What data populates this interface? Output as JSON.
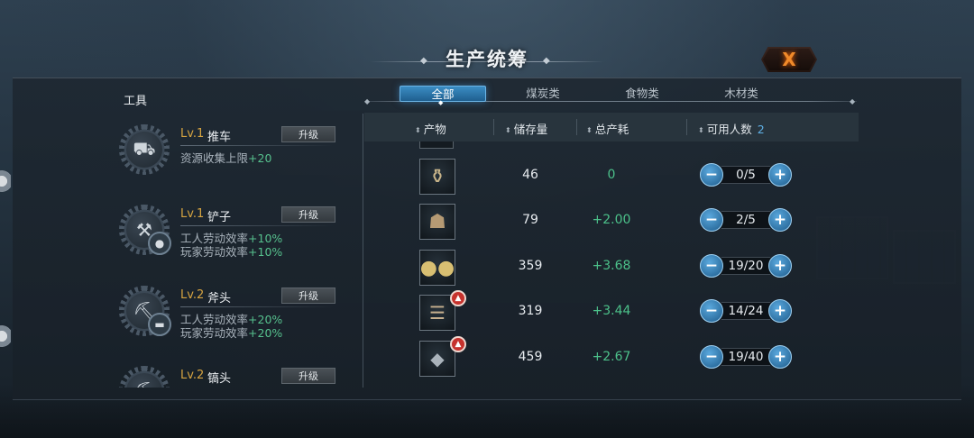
{
  "window": {
    "title": "生产统筹",
    "close_label": "X"
  },
  "tools": {
    "title": "工具",
    "upgrade_label": "升级",
    "items": [
      {
        "level": "Lv.1",
        "name": "推车",
        "effects": [
          {
            "label": "资源收集上限",
            "value": "+20"
          }
        ]
      },
      {
        "level": "Lv.1",
        "name": "铲子",
        "effects": [
          {
            "label": "工人劳动效率",
            "value": "+10%"
          },
          {
            "label": "玩家劳动效率",
            "value": "+10%"
          }
        ]
      },
      {
        "level": "Lv.2",
        "name": "斧头",
        "effects": [
          {
            "label": "工人劳动效率",
            "value": "+20%"
          },
          {
            "label": "玩家劳动效率",
            "value": "+20%"
          }
        ]
      },
      {
        "level": "Lv.2",
        "name": "镐头",
        "effects": []
      }
    ]
  },
  "tabs": [
    {
      "label": "全部",
      "active": true
    },
    {
      "label": "煤炭类",
      "active": false
    },
    {
      "label": "食物类",
      "active": false
    },
    {
      "label": "木材类",
      "active": false
    }
  ],
  "table": {
    "columns": {
      "product": "产物",
      "stock": "储存量",
      "production": "总产耗",
      "workers": "可用人数"
    },
    "available_workers": "2",
    "rows": [
      {
        "icon": "jar-icon",
        "stock": "46",
        "production": "0",
        "workers": "0/5",
        "boost": false
      },
      {
        "icon": "sack-icon",
        "stock": "79",
        "production": "+2.00",
        "workers": "2/5",
        "boost": false
      },
      {
        "icon": "potato-icon",
        "stock": "359",
        "production": "+3.68",
        "workers": "19/20",
        "boost": false
      },
      {
        "icon": "wood-log-icon",
        "stock": "319",
        "production": "+3.44",
        "workers": "14/24",
        "boost": true
      },
      {
        "icon": "coal-icon",
        "stock": "459",
        "production": "+2.67",
        "workers": "19/40",
        "boost": true
      }
    ]
  },
  "colors": {
    "accent_blue": "#3b8dc4",
    "positive_green": "#4cc18a",
    "level_gold": "#d6a441",
    "close_orange": "#f08a2a",
    "boost_red": "#c6322d"
  }
}
